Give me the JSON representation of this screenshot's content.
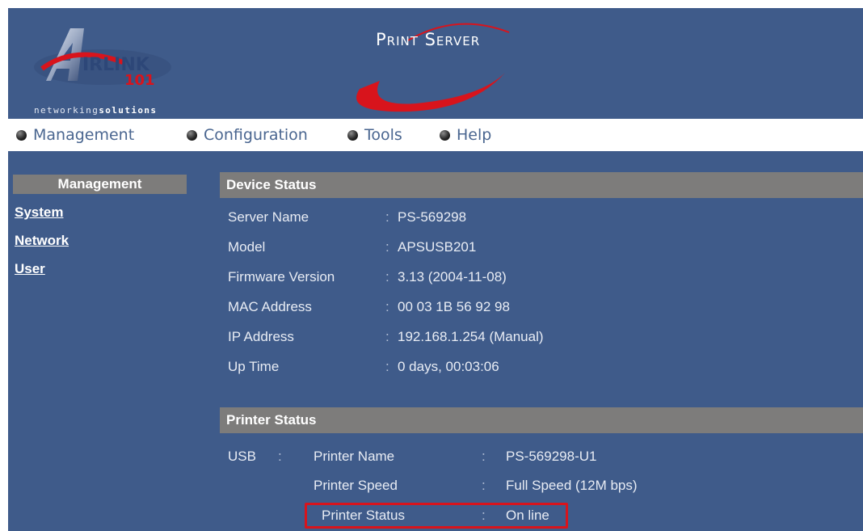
{
  "header": {
    "logo_brand": "AIRLINK 101",
    "logo_tagline_normal": "networking",
    "logo_tagline_bold": "solutions",
    "product_title": "Print Server",
    "colors": {
      "background": "#3f5b8a",
      "swoosh": "#d8141c",
      "section_bar": "#7d7c7b"
    }
  },
  "nav": {
    "items": [
      {
        "label": "Management",
        "icon": "bullet-icon"
      },
      {
        "label": "Configuration",
        "icon": "bullet-icon"
      },
      {
        "label": "Tools",
        "icon": "bullet-icon"
      },
      {
        "label": "Help",
        "icon": "bullet-icon"
      }
    ]
  },
  "sidebar": {
    "heading": "Management",
    "links": [
      "System",
      "Network",
      "User"
    ]
  },
  "device_status": {
    "title": "Device Status",
    "separator": ":",
    "rows": [
      {
        "label": "Server Name",
        "value": "PS-569298"
      },
      {
        "label": "Model",
        "value": "APSUSB201"
      },
      {
        "label": "Firmware Version",
        "value": "3.13 (2004-11-08)"
      },
      {
        "label": "MAC Address",
        "value": "00 03 1B 56 92 98"
      },
      {
        "label": "IP Address",
        "value": "192.168.1.254 (Manual)"
      },
      {
        "label": "Up Time",
        "value": "0 days, 00:03:06"
      }
    ]
  },
  "printer_status": {
    "title": "Printer Status",
    "port": "USB",
    "separator": ":",
    "rows": [
      {
        "label": "Printer Name",
        "value": "PS-569298-U1"
      },
      {
        "label": "Printer Speed",
        "value": "Full Speed (12M bps)"
      },
      {
        "label": "Printer Status",
        "value": "On line",
        "highlighted": true
      }
    ]
  }
}
